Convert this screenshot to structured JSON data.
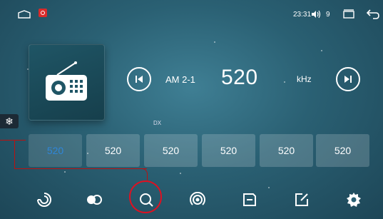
{
  "status_bar": {
    "time": "23:31",
    "volume_level": "9"
  },
  "tuner": {
    "band": "AM 2-1",
    "frequency": "520",
    "unit": "kHz",
    "dx_label": "DX"
  },
  "presets": [
    {
      "label": "520",
      "active": true
    },
    {
      "label": "520",
      "active": false
    },
    {
      "label": "520",
      "active": false
    },
    {
      "label": "520",
      "active": false
    },
    {
      "label": "520",
      "active": false
    },
    {
      "label": "520",
      "active": false
    }
  ],
  "side_tab": {
    "icon": "snowflake-icon",
    "glyph": "❄"
  },
  "toolbar": {
    "buttons": [
      {
        "name": "scan-button",
        "icon": "scan-icon"
      },
      {
        "name": "toggle-button",
        "icon": "toggle-icon"
      },
      {
        "name": "search-button",
        "icon": "search-icon"
      },
      {
        "name": "broadcast-button",
        "icon": "broadcast-icon"
      },
      {
        "name": "save-button",
        "icon": "save-icon"
      },
      {
        "name": "edit-button",
        "icon": "edit-icon"
      },
      {
        "name": "settings-button",
        "icon": "gear-icon"
      }
    ]
  },
  "colors": {
    "active_preset": "#2f86d8",
    "highlight": "#dd1122",
    "background": "#2a6073"
  }
}
